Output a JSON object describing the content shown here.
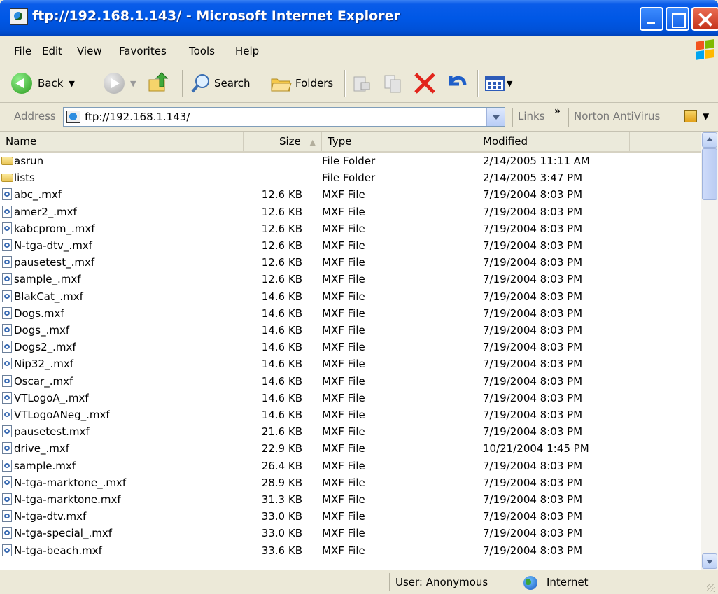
{
  "window": {
    "title": "ftp://192.168.1.143/ - Microsoft Internet Explorer"
  },
  "menu": [
    "File",
    "Edit",
    "View",
    "Favorites",
    "Tools",
    "Help"
  ],
  "toolbar": {
    "back": "Back",
    "search": "Search",
    "folders": "Folders"
  },
  "address": {
    "label": "Address",
    "value": "ftp://192.168.1.143/",
    "links": "Links",
    "norton": "Norton AntiVirus"
  },
  "columns": {
    "name": "Name",
    "size": "Size",
    "type": "Type",
    "modified": "Modified"
  },
  "files": [
    {
      "name": "asrun",
      "size": "",
      "type": "File Folder",
      "modified": "2/14/2005 11:11 AM",
      "kind": "folder"
    },
    {
      "name": "lists",
      "size": "",
      "type": "File Folder",
      "modified": "2/14/2005 3:47 PM",
      "kind": "folder"
    },
    {
      "name": "abc_.mxf",
      "size": "12.6 KB",
      "type": "MXF File",
      "modified": "7/19/2004 8:03 PM",
      "kind": "file"
    },
    {
      "name": "amer2_.mxf",
      "size": "12.6 KB",
      "type": "MXF File",
      "modified": "7/19/2004 8:03 PM",
      "kind": "file"
    },
    {
      "name": "kabcprom_.mxf",
      "size": "12.6 KB",
      "type": "MXF File",
      "modified": "7/19/2004 8:03 PM",
      "kind": "file"
    },
    {
      "name": "N-tga-dtv_.mxf",
      "size": "12.6 KB",
      "type": "MXF File",
      "modified": "7/19/2004 8:03 PM",
      "kind": "file"
    },
    {
      "name": "pausetest_.mxf",
      "size": "12.6 KB",
      "type": "MXF File",
      "modified": "7/19/2004 8:03 PM",
      "kind": "file"
    },
    {
      "name": "sample_.mxf",
      "size": "12.6 KB",
      "type": "MXF File",
      "modified": "7/19/2004 8:03 PM",
      "kind": "file"
    },
    {
      "name": "BlakCat_.mxf",
      "size": "14.6 KB",
      "type": "MXF File",
      "modified": "7/19/2004 8:03 PM",
      "kind": "file"
    },
    {
      "name": "Dogs.mxf",
      "size": "14.6 KB",
      "type": "MXF File",
      "modified": "7/19/2004 8:03 PM",
      "kind": "file"
    },
    {
      "name": "Dogs_.mxf",
      "size": "14.6 KB",
      "type": "MXF File",
      "modified": "7/19/2004 8:03 PM",
      "kind": "file"
    },
    {
      "name": "Dogs2_.mxf",
      "size": "14.6 KB",
      "type": "MXF File",
      "modified": "7/19/2004 8:03 PM",
      "kind": "file"
    },
    {
      "name": "Nip32_.mxf",
      "size": "14.6 KB",
      "type": "MXF File",
      "modified": "7/19/2004 8:03 PM",
      "kind": "file"
    },
    {
      "name": "Oscar_.mxf",
      "size": "14.6 KB",
      "type": "MXF File",
      "modified": "7/19/2004 8:03 PM",
      "kind": "file"
    },
    {
      "name": "VTLogoA_.mxf",
      "size": "14.6 KB",
      "type": "MXF File",
      "modified": "7/19/2004 8:03 PM",
      "kind": "file"
    },
    {
      "name": "VTLogoANeg_.mxf",
      "size": "14.6 KB",
      "type": "MXF File",
      "modified": "7/19/2004 8:03 PM",
      "kind": "file"
    },
    {
      "name": "pausetest.mxf",
      "size": "21.6 KB",
      "type": "MXF File",
      "modified": "7/19/2004 8:03 PM",
      "kind": "file"
    },
    {
      "name": "drive_.mxf",
      "size": "22.9 KB",
      "type": "MXF File",
      "modified": "10/21/2004 1:45 PM",
      "kind": "file"
    },
    {
      "name": "sample.mxf",
      "size": "26.4 KB",
      "type": "MXF File",
      "modified": "7/19/2004 8:03 PM",
      "kind": "file"
    },
    {
      "name": "N-tga-marktone_.mxf",
      "size": "28.9 KB",
      "type": "MXF File",
      "modified": "7/19/2004 8:03 PM",
      "kind": "file"
    },
    {
      "name": "N-tga-marktone.mxf",
      "size": "31.3 KB",
      "type": "MXF File",
      "modified": "7/19/2004 8:03 PM",
      "kind": "file"
    },
    {
      "name": "N-tga-dtv.mxf",
      "size": "33.0 KB",
      "type": "MXF File",
      "modified": "7/19/2004 8:03 PM",
      "kind": "file"
    },
    {
      "name": "N-tga-special_.mxf",
      "size": "33.0 KB",
      "type": "MXF File",
      "modified": "7/19/2004 8:03 PM",
      "kind": "file"
    },
    {
      "name": "N-tga-beach.mxf",
      "size": "33.6 KB",
      "type": "MXF File",
      "modified": "7/19/2004 8:03 PM",
      "kind": "file"
    }
  ],
  "status": {
    "user": "User: Anonymous",
    "zone": "Internet"
  }
}
